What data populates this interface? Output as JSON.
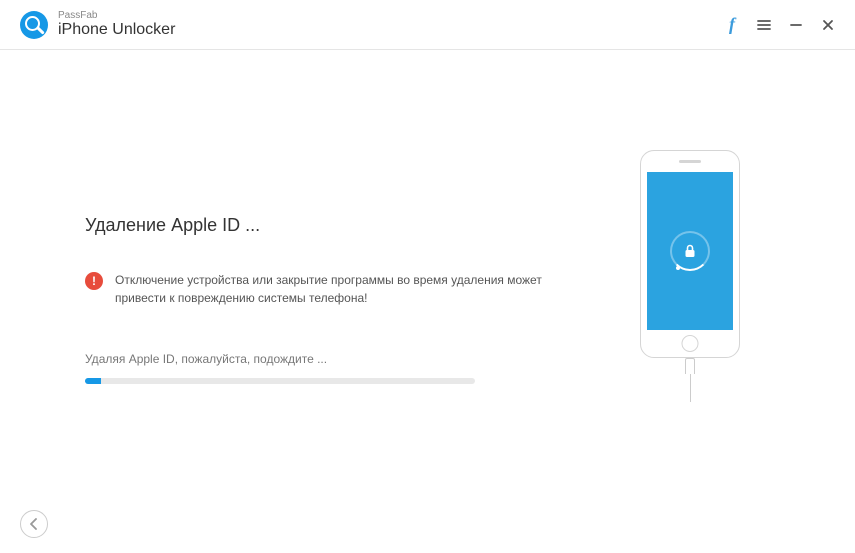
{
  "header": {
    "brand_small": "PassFab",
    "brand_title": "iPhone Unlocker"
  },
  "main": {
    "heading": "Удаление Apple ID ...",
    "warning": "Отключение устройства или закрытие программы во время удаления может привести к повреждению системы телефона!",
    "progress_label": "Удаляя Apple ID, пожалуйста, подождите ...",
    "progress_percent": 4
  },
  "icons": {
    "facebook": "f",
    "menu": "≡",
    "minimize": "–",
    "close": "✕",
    "warning_mark": "!",
    "back_chevron": "‹"
  },
  "colors": {
    "accent": "#1698e6",
    "danger": "#e74c3c"
  }
}
